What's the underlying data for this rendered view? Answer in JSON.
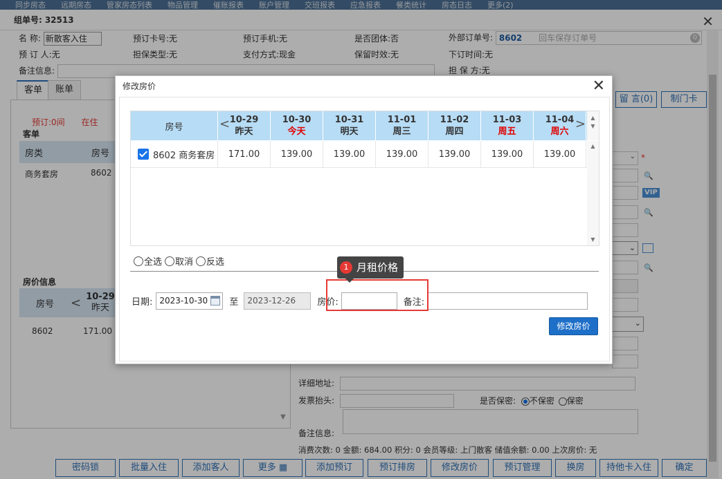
{
  "top_nav": [
    "同步房态",
    "远期房态",
    "管家房态列表",
    "物品管理",
    "催账报表",
    "账户管理",
    "交班报表",
    "应急报表",
    "餐类统计",
    "房态日志",
    "更多(2)"
  ],
  "window": {
    "title_label": "组单号:",
    "title_value": "32513"
  },
  "info": {
    "name_label": "名      称:",
    "name_value": "新散客入住",
    "booking_card_label": "预订卡号:",
    "booking_card_value": "无",
    "booking_phone_label": "预订手机:",
    "booking_phone_value": "无",
    "is_group_label": "是否团体:",
    "is_group_value": "否",
    "external_order_label": "外部订单号:",
    "external_order_value": "8602",
    "external_order_placeholder": "回车保存订单号",
    "external_order_count": "0",
    "booker_label": "预 订 人:",
    "booker_value": "无",
    "guarantee_type_label": "担保类型:",
    "guarantee_type_value": "无",
    "payment_label": "支付方式:",
    "payment_value": "现金",
    "retention_label": "保留时效:",
    "retention_value": "无",
    "order_time_label": "下订时间:",
    "order_time_value": "无",
    "remark_label": "备注信息:",
    "guarantor_label": "担 保 方:",
    "guarantor_value": "无"
  },
  "tabs": [
    "客单",
    "账单"
  ],
  "left": {
    "booked_label": "预订:",
    "booked_value": "0间",
    "checkin_partial": "在住",
    "guest_section": "客单",
    "guest_headers": [
      "房类",
      "房号"
    ],
    "guest_row": [
      "商务套房",
      "8602"
    ],
    "price_section": "房价信息",
    "price_head_room": "房号",
    "price_head_date": "10-29",
    "price_head_day": "昨天",
    "price_row_room": "8602",
    "price_row_value": "171.00"
  },
  "right": {
    "msg_button": "留 言(0)",
    "card_button": "制门卡",
    "vip": "VIP",
    "address_label": "详细地址:",
    "invoice_label": "发票抬头:",
    "secret_label": "是否保密:",
    "secret_no": "不保密",
    "secret_yes": "保密",
    "remark_label": "备注信息:",
    "stats": "消费次数: 0 金额: 684.00 积分: 0 会员等级: 上门散客 储值余额: 0.00 上次房价: 无"
  },
  "bottom_buttons": [
    "密码锁",
    "批量入住",
    "添加客人",
    "更多",
    "添加预订",
    "预订排房",
    "修改房价",
    "预订管理",
    "换房",
    "持他卡入住",
    "确定"
  ],
  "modal": {
    "title": "修改房价",
    "grid": {
      "room_header": "房号",
      "dates": [
        {
          "date": "10-29",
          "day": "昨天",
          "red": false
        },
        {
          "date": "10-30",
          "day": "今天",
          "red": true
        },
        {
          "date": "10-31",
          "day": "明天",
          "red": false
        },
        {
          "date": "11-01",
          "day": "周三",
          "red": false
        },
        {
          "date": "11-02",
          "day": "周四",
          "red": false
        },
        {
          "date": "11-03",
          "day": "周五",
          "red": true
        },
        {
          "date": "11-04",
          "day": "周六",
          "red": true
        }
      ],
      "row": {
        "room": "8602 商务套房",
        "checked": true,
        "prices": [
          "171.00",
          "139.00",
          "139.00",
          "139.00",
          "139.00",
          "139.00",
          "139.00"
        ]
      }
    },
    "select_all": "全选",
    "cancel_select": "取消",
    "invert_select": "反选",
    "date_label": "日期:",
    "date_from": "2023-10-30",
    "to_label": "至",
    "date_to": "2023-12-26",
    "price_label": "房价:",
    "price_value": "",
    "note_label": "备注:",
    "note_value": "",
    "submit": "修改房价",
    "tooltip_number": "1",
    "tooltip_text": "月租价格"
  }
}
